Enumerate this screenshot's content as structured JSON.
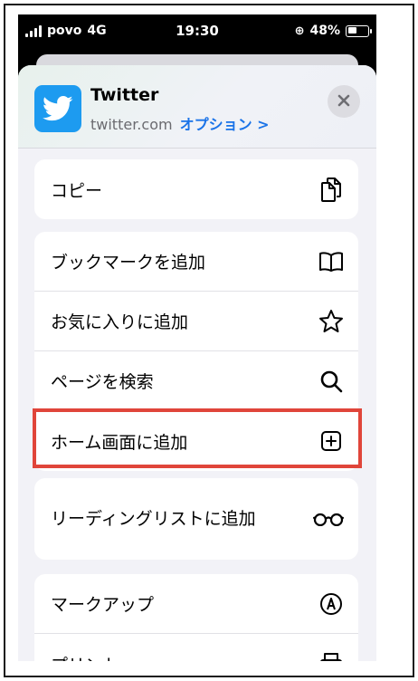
{
  "status_bar": {
    "carrier": "povo",
    "network": "4G",
    "time": "19:30",
    "battery_text": "48%",
    "battery_level": 0.48
  },
  "share_header": {
    "app_name": "Twitter",
    "domain": "twitter.com",
    "options_link": "オプション >",
    "close_icon": "close-icon",
    "app_icon": "twitter-bird-icon"
  },
  "actions": {
    "copy": {
      "label": "コピー",
      "icon": "copy-icon"
    },
    "add_bookmark": {
      "label": "ブックマークを追加",
      "icon": "book-icon"
    },
    "add_favorite": {
      "label": "お気に入りに追加",
      "icon": "star-icon"
    },
    "find_on_page": {
      "label": "ページを検索",
      "icon": "search-icon"
    },
    "add_to_home": {
      "label": "ホーム画面に追加",
      "icon": "plus-square-icon"
    },
    "reading_list": {
      "label": "リーディングリストに追加",
      "icon": "glasses-icon"
    },
    "markup": {
      "label": "マークアップ",
      "icon": "pen-circle-icon"
    },
    "print": {
      "label": "プリント",
      "icon": "printer-icon"
    }
  },
  "colors": {
    "accent": "#1a73e8",
    "twitter": "#1d9bf0",
    "highlight": "#e0453a",
    "sheet_bg": "#f2f2f7"
  }
}
